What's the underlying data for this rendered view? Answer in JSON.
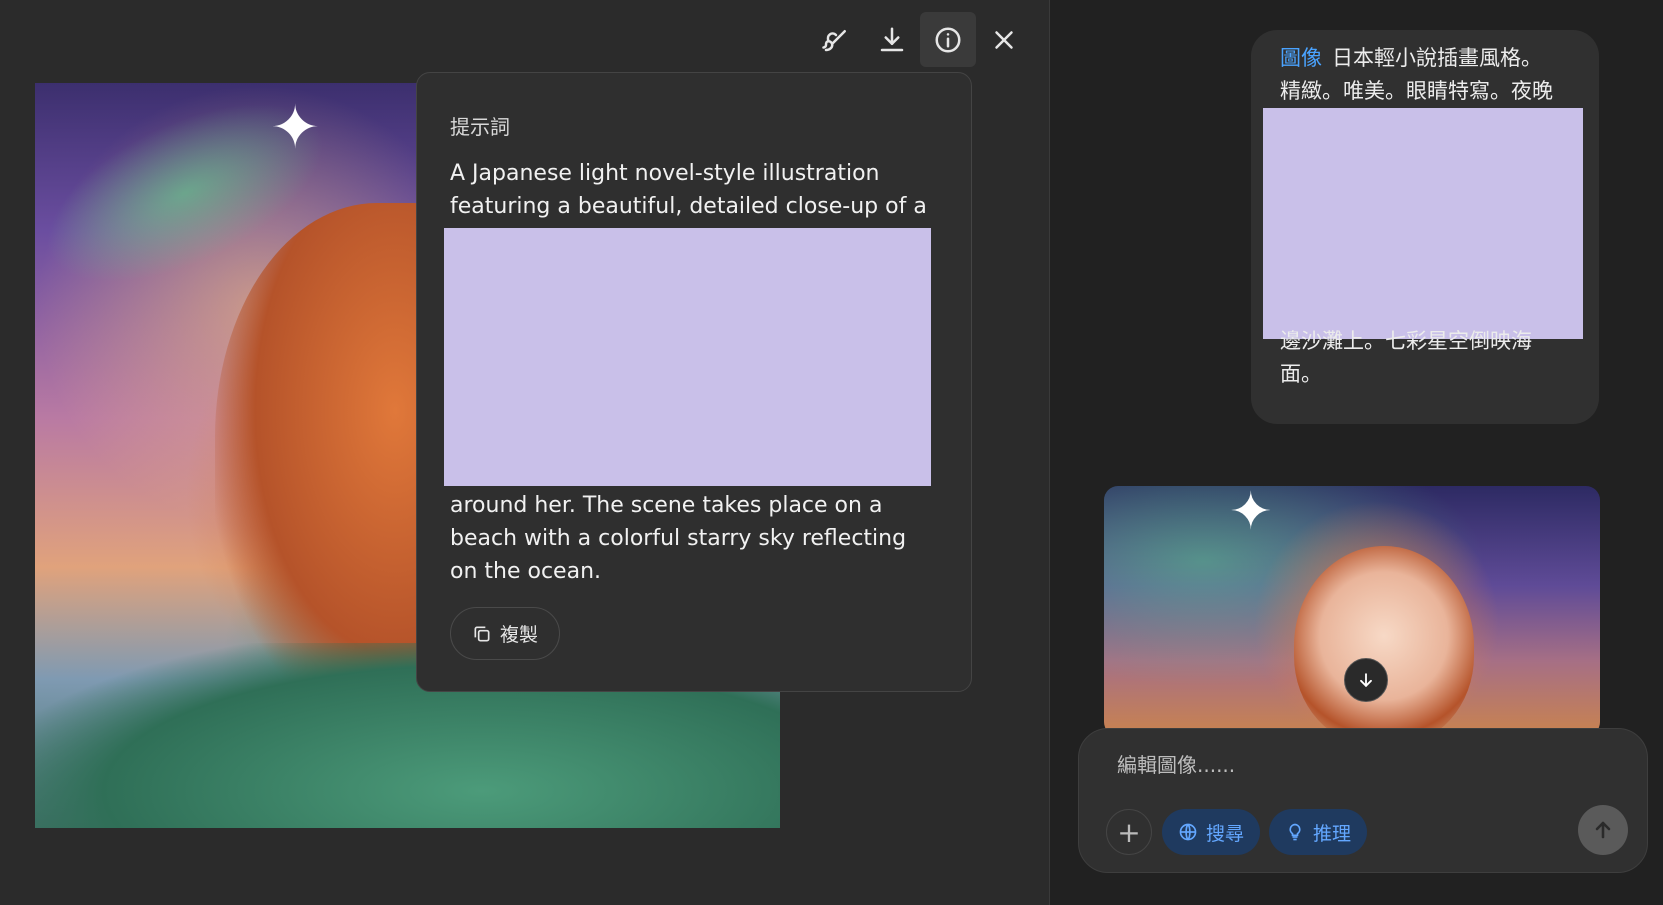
{
  "popover": {
    "title": "提示詞",
    "prompt_before": "A Japanese light novel-style illustration featuring a beautiful, detailed close-up of a",
    "prompt_after": "around her. The scene takes place on a beach with a colorful starry sky reflecting on the ocean.",
    "copy_label": "複製"
  },
  "chat": {
    "user_bubble": {
      "tag": "圖像",
      "line1": "日本輕小說插畫風格。",
      "line2": "精緻。唯美。眼睛特寫。夜晚",
      "line3": "邊沙灘上。七彩星空倒映海",
      "line4": "面。"
    }
  },
  "composer": {
    "placeholder": "編輯圖像......",
    "search_label": "搜尋",
    "reason_label": "推理"
  }
}
